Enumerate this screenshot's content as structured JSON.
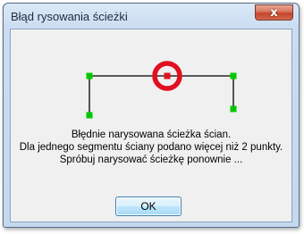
{
  "dialog": {
    "title": "Błąd rysowania ścieżki",
    "close_label": "x",
    "message_lines": [
      "Błędnie narysowana ścieżka ścian.",
      "Dla jednego segmentu ściany podano więcej niż 2 punkty.",
      "Spróbuj narysować ścieżkę ponownie ..."
    ],
    "ok_label": "OK"
  },
  "diagram": {
    "icon": "invalid-wall-path-icon",
    "colors": {
      "path": "#000000",
      "point": "#00c800",
      "error_marker": "#e01020"
    }
  },
  "colors": {
    "window_frame": "#c4d8ee",
    "client_background": "#f0f0f0",
    "close_button": "#c4442c",
    "ok_button_border": "#3c7fb1"
  }
}
